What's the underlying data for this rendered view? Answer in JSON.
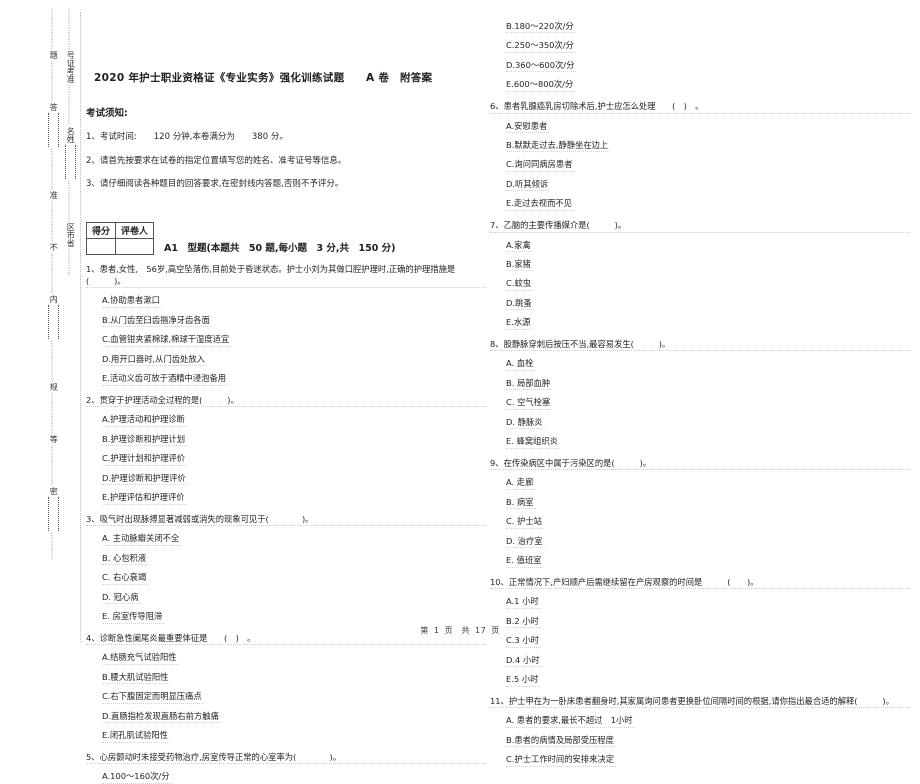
{
  "seal_margin": {
    "column_a": [
      "题",
      "答",
      "准",
      "不",
      "内",
      "规",
      "等",
      "密"
    ],
    "column_b": [
      "号证考准",
      "名姓",
      "区市省"
    ],
    "dots": "……"
  },
  "document": {
    "title": "2020 年护士职业资格证《专业实务》强化训练试题　　A 卷　附答案",
    "notice_heading": "考试须知:",
    "notices": [
      "1、考试时间:　　120 分钟,本卷满分为　　380 分。",
      "2、请首先按要求在试卷的指定位置填写您的姓名、准考证号等信息。",
      "3、请仔细阅读各种题目的回答要求,在密封线内答题,否则不予评分。"
    ],
    "score_table": {
      "headers": [
        "得分",
        "评卷人"
      ],
      "cells": [
        "",
        ""
      ]
    },
    "section_title": "A1　型题(本题共　50 题,每小题　3 分,共　150 分)",
    "footer": {
      "prefix": "第",
      "page": "1",
      "middle": "页　共",
      "total": "17",
      "suffix": "页"
    }
  },
  "questions_left": [
    {
      "stem": "1、患者,女性,　56岁,高空坠落伤,目前处于昏迷状态。护士小刘为其做口腔护理时,正确的护理措施是(　　　)。",
      "options": [
        "A.协助患者漱口",
        "B.从门齿至臼齿揩净牙齿各面",
        "C.血管钳夹紧棉球,棉球干湿度适宜",
        "D.用开口器时,从门齿处放入",
        "E.活动义齿可放于酒精中浸泡备用"
      ]
    },
    {
      "stem": "2、贯穿于护理活动全过程的是(　　　)。",
      "options": [
        "A.护理活动和护理诊断",
        "B.护理诊断和护理计划",
        "C.护理计划和护理评价",
        "D.护理诊断和护理评价",
        "E.护理评估和护理评价"
      ]
    },
    {
      "stem": "3、吸气时出现脉搏显著减弱或消失的现象可见于(　　　　)。",
      "options": [
        "A. 主动脉瓣关闭不全",
        "B. 心包积液",
        "C. 右心衰竭",
        "D. 冠心病",
        "E. 房室传导阻滞"
      ]
    },
    {
      "stem": "4、诊断急性阑尾炎最重要体征是　　(　)　。",
      "options": [
        "A.结肠充气试验阳性",
        "B.腰大肌试验阳性",
        "C.右下腹固定而明显压痛点",
        "D.直肠指检发现直肠右前方触痛",
        "E.闭孔肌试验阳性"
      ]
    },
    {
      "stem": "5、心房颤动时未接受药物治疗,房室传导正常的心室率为(　　　　)。",
      "options": [
        "A.100～160次/分"
      ]
    }
  ],
  "questions_right": [
    {
      "stem": "",
      "options": [
        "B.180～220次/分",
        "C.250～350次/分",
        "D.360～600次/分",
        "E.600～800次/分"
      ]
    },
    {
      "stem": "6、患者乳腺癌乳房切除术后,护士应怎么处理　　(　)　。",
      "options": [
        "A.安慰患者",
        "B.默默走过去,静静坐在边上",
        "C.询问同病房患者",
        "D.听其倾诉",
        "E.走过去视而不见"
      ]
    },
    {
      "stem": "7、乙脑的主要传播媒介是(　　　)。",
      "options": [
        "A.家禽",
        "B.家猪",
        "C.蚊虫",
        "D.跳蚤",
        "E.水源"
      ]
    },
    {
      "stem": "8、股静脉穿刺后按压不当,最容易发生(　　　)。",
      "options": [
        "A. 血栓",
        "B. 局部血肿",
        "C. 空气栓塞",
        "D. 静脉炎",
        "E. 蜂窝组织炎"
      ]
    },
    {
      "stem": "9、在传染病区中属于污染区的是(　　　)。",
      "options": [
        "A. 走廊",
        "B. 病室",
        "C. 护士站",
        "D. 治疗室",
        "E. 值班室"
      ]
    },
    {
      "stem": "10、正常情况下,产妇顺产后需继续留在产房观察的时间是　　　(　　)。",
      "options": [
        "A.1 小时",
        "B.2 小时",
        "C.3 小时",
        "D.4 小时",
        "E.5 小时"
      ]
    },
    {
      "stem": "11、护士甲在为一卧床患者翻身时,其家属询问患者更换卧位间隔时间的根据,请你指出最合适的解释(　　　)。",
      "options": [
        "A. 患者的要求,最长不超过　1小时",
        "B.患者的病情及局部受压程度",
        "C.护士工作时间的安排来决定"
      ]
    }
  ]
}
